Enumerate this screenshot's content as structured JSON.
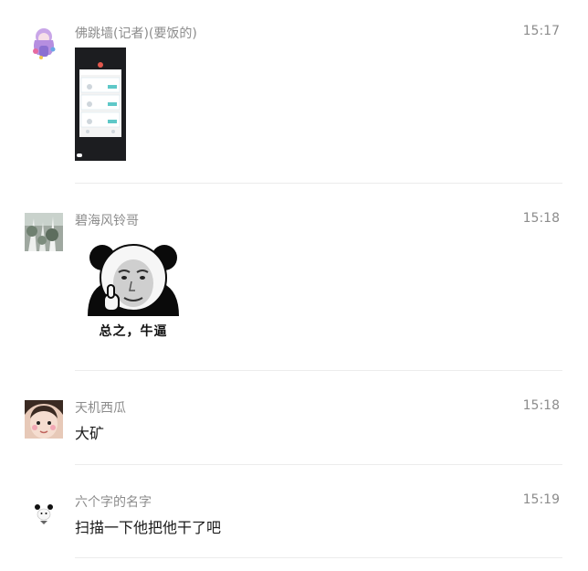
{
  "messages": [
    {
      "sender": "佛跳墙(记者)(要饭的)",
      "time": "15:17",
      "content_type": "image",
      "image": {
        "kind": "phone-screenshot-thumbnail"
      }
    },
    {
      "sender": "碧海风铃哥",
      "time": "15:18",
      "content_type": "sticker",
      "sticker": {
        "kind": "panda-meme-thumbs-up",
        "caption": "总之，牛逼"
      }
    },
    {
      "sender": "天机西瓜",
      "time": "15:18",
      "content_type": "text",
      "text": "大矿"
    },
    {
      "sender": "六个字的名字",
      "time": "15:19",
      "content_type": "text",
      "text": "扫描一下他把他干了吧"
    }
  ],
  "colors": {
    "meta_text": "#8c8c8c",
    "body_text": "#1a1a1a",
    "divider": "#ececec"
  }
}
